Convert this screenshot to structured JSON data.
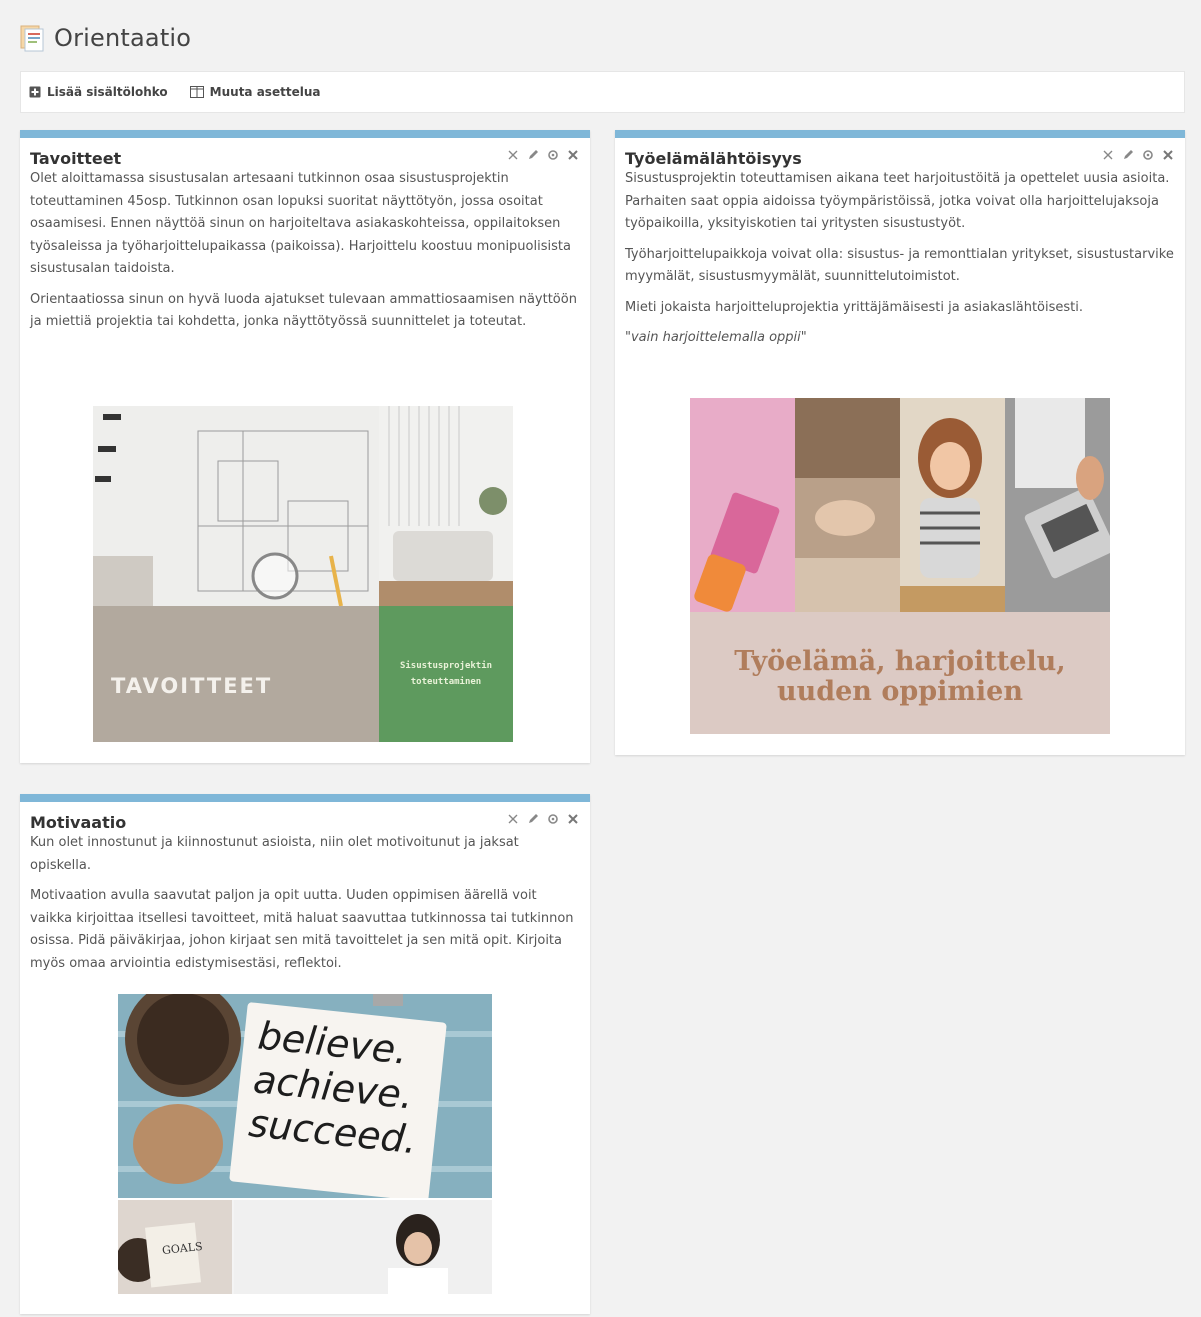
{
  "page": {
    "title": "Orientaatio"
  },
  "toolbar": {
    "add_block_label": "Lisää sisältölohko",
    "change_layout_label": "Muuta asettelua"
  },
  "blocks": {
    "tavoitteet": {
      "title": "Tavoitteet",
      "paragraphs": [
        "Olet aloittamassa sisustusalan artesaani tutkinnon osaa sisustusprojektin toteuttaminen 45osp. Tutkinnon osan lopuksi suoritat näyttötyön, jossa osoitat osaamisesi. Ennen näyttöä sinun on harjoiteltava asiakaskohteissa, oppilaitoksen työsaleissa ja työharjoittelupaikassa (paikoissa). Harjoittelu koostuu monipuolisista sisustusalan taidoista.",
        "Orientaatiossa sinun on hyvä luoda ajatukset tulevaan ammattiosaamisen näyttöön ja miettiä projektia tai kohdetta, jonka näyttötyössä suunnittelet ja toteutat."
      ],
      "image": {
        "big_text": "TAVOITTEET",
        "small_text_1": "Sisustusprojektin",
        "small_text_2": "toteuttaminen"
      }
    },
    "tyoelama": {
      "title": "Työelämälähtöisyys",
      "paragraphs": [
        "Sisustusprojektin toteuttamisen aikana teet harjoitustöitä ja opettelet uusia asioita. Parhaiten saat oppia aidoissa työympäristöissä, jotka voivat olla harjoittelujaksoja työpaikoilla, yksityiskotien tai yritysten sisustustyöt.",
        "Työharjoittelupaikkoja voivat olla: sisustus- ja remonttialan yritykset, sisustustarvike myymälät, sisustusmyymälät, suunnittelutoimistot.",
        "Mieti jokaista harjoitteluprojektia yrittäjämäisesti ja asiakaslähtöisesti."
      ],
      "quote": "\"vain harjoittelemalla oppii\"",
      "image": {
        "line_1": "Työelämä, harjoittelu,",
        "line_2": "uuden oppimien"
      }
    },
    "motivaatio": {
      "title": "Motivaatio",
      "paragraphs": [
        "Kun olet innostunut ja kiinnostunut asioista, niin olet motivoitunut ja jaksat opiskella.",
        "Motivaation avulla saavutat paljon ja opit uutta. Uuden oppimisen äärellä voit vaikka kirjoittaa itsellesi tavoitteet, mitä haluat saavuttaa tutkinnossa tai tutkinnon osissa. Pidä päiväkirjaa, johon kirjaat sen mitä tavoittelet ja sen mitä opit. Kirjoita myös omaa arviointia edistymisestäsi, reflektoi."
      ],
      "image": {
        "word_1": "believe.",
        "word_2": "achieve.",
        "word_3": "succeed.",
        "notebook_label": "GOALS"
      }
    }
  },
  "icons": {
    "page": "document-pages-icon",
    "add": "plus-square-icon",
    "layout": "columns-icon",
    "controls": [
      "minimize-icon",
      "edit-pencil-icon",
      "settings-icon",
      "close-icon"
    ]
  },
  "colors": {
    "block_accent": "#7fb7d8",
    "background": "#f2f2f2"
  }
}
